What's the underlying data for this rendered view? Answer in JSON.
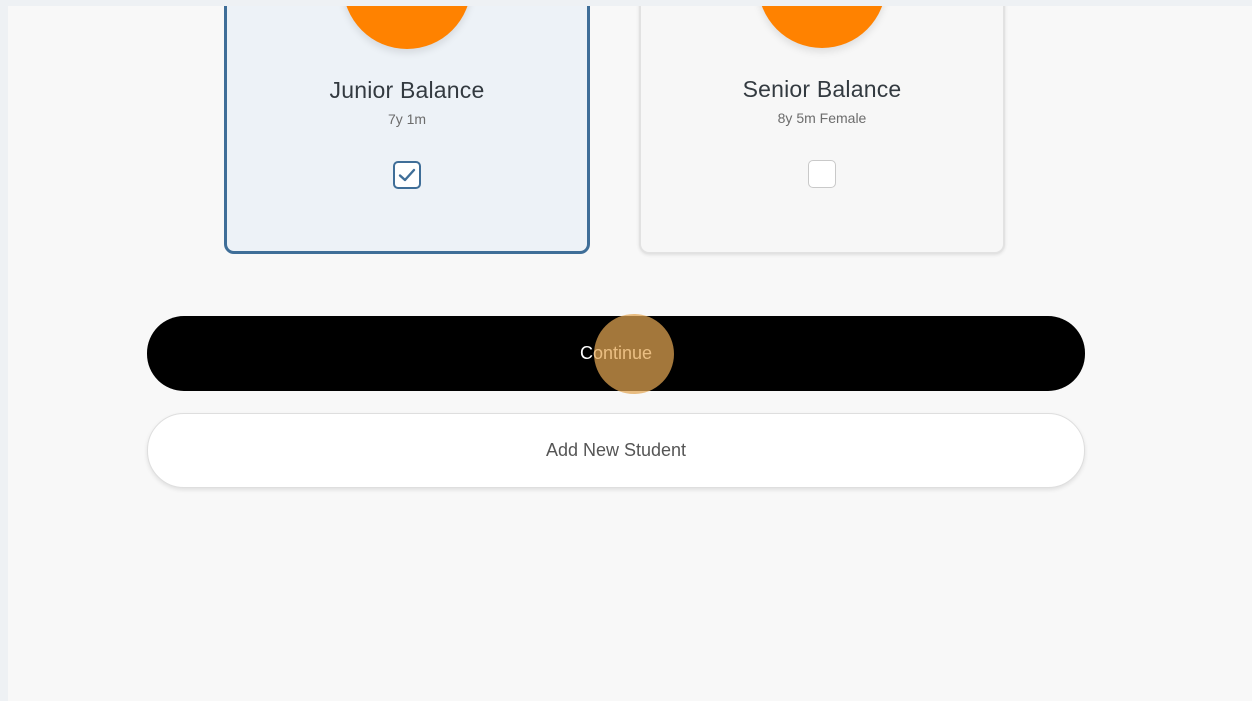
{
  "students": [
    {
      "name": "Junior Balance",
      "meta": "7y 1m",
      "selected": true
    },
    {
      "name": "Senior Balance",
      "meta": "8y 5m Female",
      "selected": false
    }
  ],
  "actions": {
    "continue_label": "Continue",
    "add_student_label": "Add New Student"
  },
  "colors": {
    "avatar": "#ff8200",
    "selected_border": "#3f6e98",
    "primary_button": "#000000",
    "click_indicator": "#e2a552"
  },
  "icons": {
    "check": "checkmark-icon"
  }
}
